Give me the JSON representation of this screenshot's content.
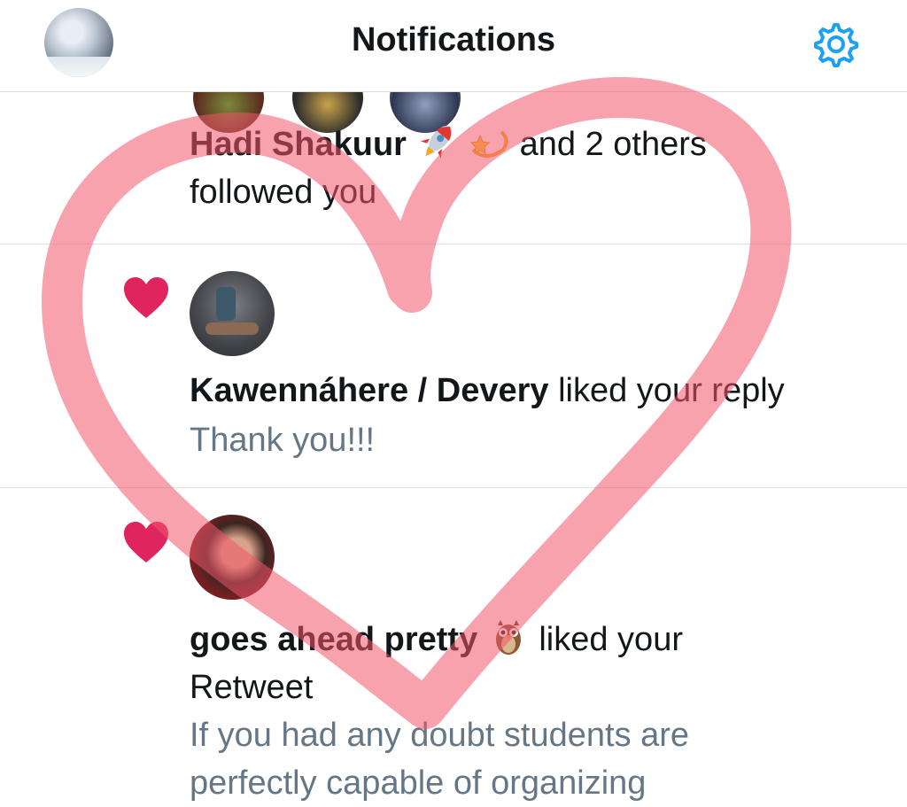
{
  "header": {
    "title": "Notifications",
    "accent_color": "#1da1f2",
    "settings_icon": "gear-icon"
  },
  "notifications": [
    {
      "type": "follow",
      "name": "Hadi Shakuur",
      "name_emojis": [
        "rocket-emoji",
        "dizzy-emoji"
      ],
      "action_part1": "and 2 others",
      "action_part2": "followed you"
    },
    {
      "type": "like",
      "icon": "heart-icon",
      "name": "Kawennáhere / Devery",
      "action": "liked your reply",
      "content": "Thank you!!!"
    },
    {
      "type": "like",
      "icon": "heart-icon",
      "name": "goes ahead pretty",
      "name_emoji": "owl-emoji",
      "action_part1": "liked your",
      "action_part2": "Retweet",
      "content_line1": "If you had any doubt students are",
      "content_line2": "perfectly capable of organizing"
    }
  ],
  "colors": {
    "text": "#14171a",
    "muted": "#657786",
    "like_heart": "#e0245e",
    "divider": "#dfe3e7",
    "overlay_heart": "#f0556a"
  }
}
